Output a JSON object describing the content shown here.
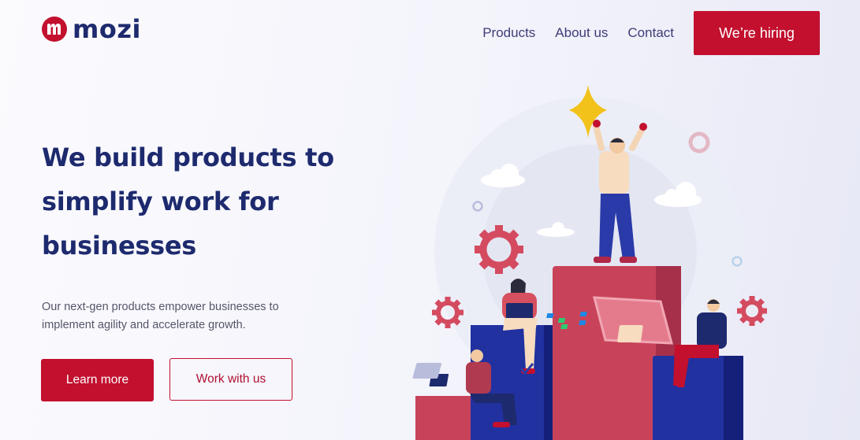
{
  "brand": {
    "name": "mozi",
    "logo_icon": "mozi-logo-mark",
    "color": "#c2102e",
    "text_color": "#1e2a6e"
  },
  "nav": {
    "links": [
      "Products",
      "About us",
      "Contact"
    ],
    "cta_label": "We’re hiring"
  },
  "hero": {
    "title": "We build products to simplify work for businesses",
    "subtitle": "Our next-gen products empower businesses to implement agility and accelerate growth.",
    "primary_button": "Learn more",
    "secondary_button": "Work with us"
  },
  "colors": {
    "accent": "#c2102e",
    "navy": "#1e2a6e",
    "pillar_red": "#c8435a",
    "pillar_navy": "#1e2a8a"
  }
}
